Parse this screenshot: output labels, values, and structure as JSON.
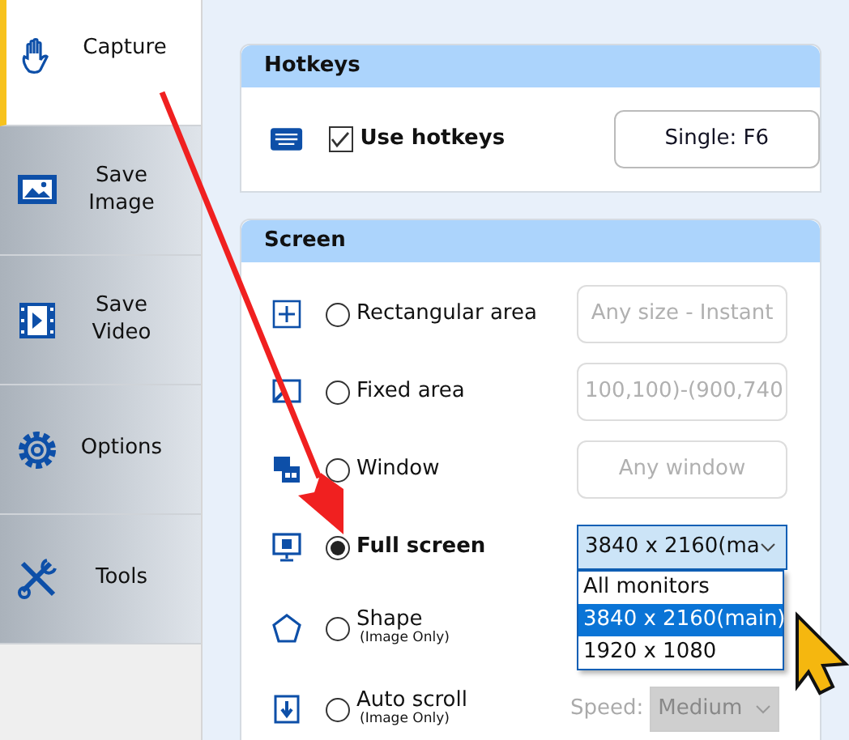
{
  "sidebar": {
    "items": [
      {
        "label": "Capture",
        "selected": true
      },
      {
        "label": "Save Image",
        "selected": false
      },
      {
        "label": "Save Video",
        "selected": false
      },
      {
        "label": "Options",
        "selected": false
      },
      {
        "label": "Tools",
        "selected": false
      }
    ]
  },
  "hotkeys": {
    "title": "Hotkeys",
    "checkbox": {
      "label": "Use hotkeys",
      "checked": true
    },
    "button": "Single: F6"
  },
  "screen": {
    "title": "Screen",
    "modes": [
      {
        "label": "Rectangular area",
        "selected": false,
        "control": {
          "kind": "button",
          "text": "Any size - Instant"
        }
      },
      {
        "label": "Fixed area",
        "selected": false,
        "control": {
          "kind": "button",
          "text": "100,100)-(900,740"
        }
      },
      {
        "label": "Window",
        "selected": false,
        "control": {
          "kind": "button",
          "text": "Any window"
        }
      },
      {
        "label": "Full screen",
        "selected": true,
        "control": {
          "kind": "select",
          "text": "3840 x 2160(ma",
          "expanded": true,
          "options": [
            {
              "label": "All monitors",
              "selected": false
            },
            {
              "label": "3840 x 2160(main)",
              "selected": true
            },
            {
              "label": "1920 x 1080",
              "selected": false
            }
          ]
        }
      },
      {
        "label": "Shape",
        "sublabel": "(Image Only)",
        "selected": false
      },
      {
        "label": "Auto scroll",
        "sublabel": "(Image Only)",
        "selected": false,
        "control": {
          "kind": "speed",
          "caption": "Speed:",
          "text": "Medium",
          "disabled": true
        }
      }
    ]
  }
}
